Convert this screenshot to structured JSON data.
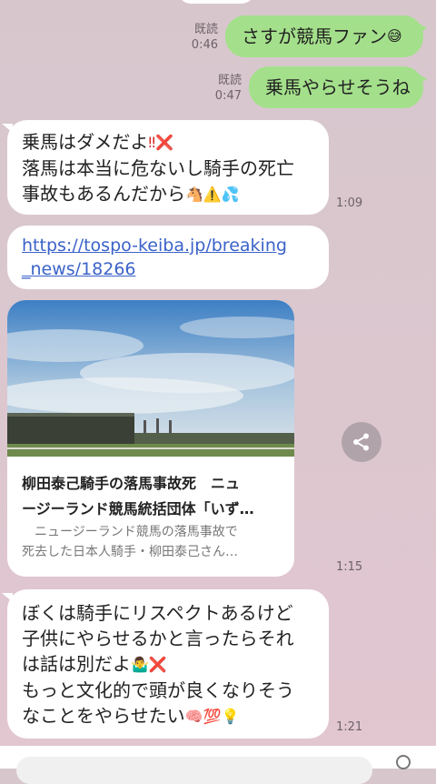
{
  "messages": {
    "m1": {
      "read": "既読",
      "time": "0:46",
      "text": "さすが競馬ファン",
      "emoji": "😅"
    },
    "m2": {
      "read": "既読",
      "time": "0:47",
      "text": "乗馬やらせそうね"
    },
    "m3": {
      "line1": "乗馬はダメだよ",
      "line1_emoji": "‼❌",
      "line2": "落馬は本当に危ないし騎手の死亡",
      "line3": "事故もあるんだから",
      "line3_emoji": "🐴⚠️💦",
      "time": "1:09"
    },
    "m4": {
      "url_line1": "https://tospo-keiba.jp/breaking",
      "url_line2": "_news/18266"
    },
    "m5": {
      "title_line1": "柳田泰己騎手の落馬事故死　ニュ",
      "title_line2": "ージーランド競馬統括団体「いず…",
      "desc_line1": "　ニュージーランド競馬の落馬事故で",
      "desc_line2": "死去した日本人騎手・柳田泰己さん…",
      "time": "1:15"
    },
    "m6": {
      "line1": "ぼくは騎手にリスペクトあるけど",
      "line2": "子供にやらせるかと言ったらそれ",
      "line3": "は話は別だよ",
      "line3_emoji": "🤷‍♂️❌",
      "line4": "もっと文化的で頭が良くなりそう",
      "line5": "なことをやらせたい",
      "line5_emoji": "🧠💯💡",
      "time": "1:21"
    }
  },
  "icons": {
    "share": "share-icon"
  },
  "colors": {
    "sent_bubble": "#a4e08b",
    "received_bubble": "#ffffff",
    "link": "#3b63c9"
  }
}
